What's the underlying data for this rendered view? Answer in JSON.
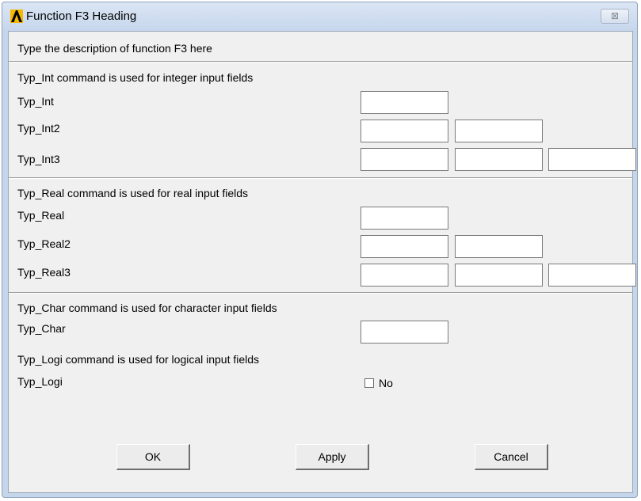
{
  "window": {
    "title": "Function F3 Heading",
    "close_glyph": "⊠"
  },
  "description": "Type the description of function F3 here",
  "sections": {
    "int": {
      "heading": "Typ_Int command is used for integer input fields",
      "rows": [
        {
          "label": "Typ_Int",
          "fields": [
            ""
          ]
        },
        {
          "label": "Typ_Int2",
          "fields": [
            "",
            ""
          ]
        },
        {
          "label": "Typ_Int3",
          "fields": [
            "",
            "",
            ""
          ]
        }
      ]
    },
    "real": {
      "heading": "Typ_Real command is used for real input fields",
      "rows": [
        {
          "label": "Typ_Real",
          "fields": [
            ""
          ]
        },
        {
          "label": "Typ_Real2",
          "fields": [
            "",
            ""
          ]
        },
        {
          "label": "Typ_Real3",
          "fields": [
            "",
            "",
            ""
          ]
        }
      ]
    },
    "char": {
      "heading": "Typ_Char command is used for character input fields",
      "label": "Typ_Char",
      "value": ""
    },
    "logi": {
      "heading": "Typ_Logi command is used for logical input fields",
      "label": "Typ_Logi",
      "checkbox_label": "No",
      "checked": false
    }
  },
  "buttons": {
    "ok": "OK",
    "apply": "Apply",
    "cancel": "Cancel"
  },
  "icons": {
    "app": "ansys-logo-icon",
    "close": "close-icon"
  },
  "colors": {
    "frame": "#c5d5ea",
    "client": "#f0f0f0",
    "logo_yellow": "#f5b800"
  }
}
